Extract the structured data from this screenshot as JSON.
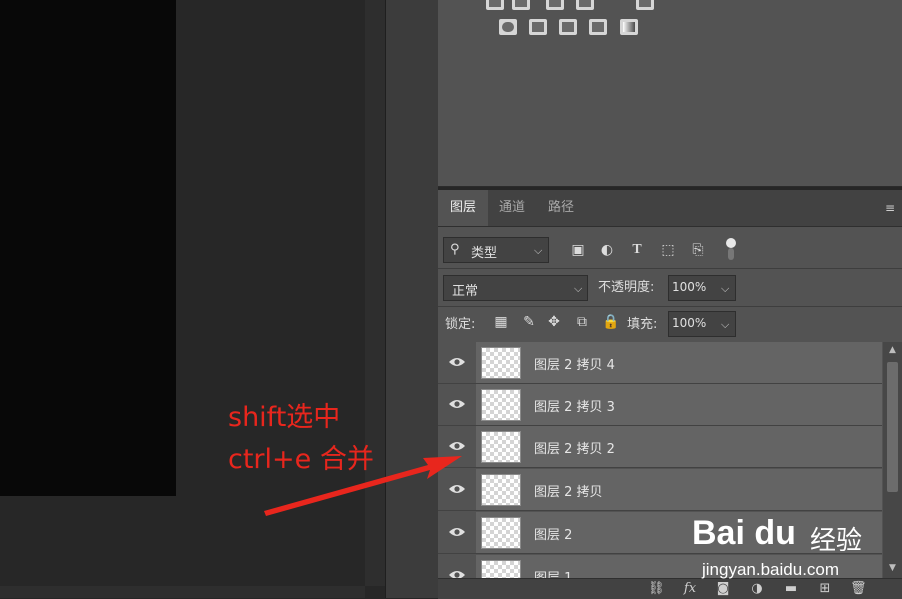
{
  "layers_panel": {
    "tabs": [
      {
        "label": "图层",
        "active": true
      },
      {
        "label": "通道",
        "active": false
      },
      {
        "label": "路径",
        "active": false
      }
    ],
    "filter": {
      "label": "类型",
      "icon": "search-icon"
    },
    "filter_icons": [
      "image-filter-icon",
      "adjustment-filter-icon",
      "type-filter-icon",
      "shape-filter-icon",
      "smart-object-filter-icon",
      "filter-toggle-icon"
    ],
    "blend_mode": "正常",
    "opacity_label": "不透明度:",
    "opacity_value": "100%",
    "lock_label": "锁定:",
    "lock_icons": [
      "lock-transparent-icon",
      "lock-image-icon",
      "lock-position-icon",
      "lock-artboard-icon",
      "lock-all-icon"
    ],
    "fill_label": "填充:",
    "fill_value": "100%",
    "layers": [
      {
        "name": "图层 2 拷贝 4",
        "visible": true
      },
      {
        "name": "图层 2 拷贝 3",
        "visible": true
      },
      {
        "name": "图层 2 拷贝 2",
        "visible": true
      },
      {
        "name": "图层 2 拷贝",
        "visible": true
      },
      {
        "name": "图层 2",
        "visible": true
      },
      {
        "name": "图层 1",
        "visible": true
      }
    ],
    "bottom_icons": [
      "link-icon",
      "fx-icon",
      "mask-icon",
      "adjustment-icon",
      "folder-icon",
      "new-layer-icon",
      "trash-icon"
    ]
  },
  "annotation": {
    "text": "shift选中\nctrl+e 合并",
    "color": "#e8261d"
  },
  "watermark": {
    "logo": "Bai du",
    "brand": "经验",
    "url": "jingyan.baidu.com"
  },
  "colors": {
    "panel": "#535353",
    "workspace": "#272727",
    "canvas": "#080808",
    "annotation": "#e8261d"
  }
}
